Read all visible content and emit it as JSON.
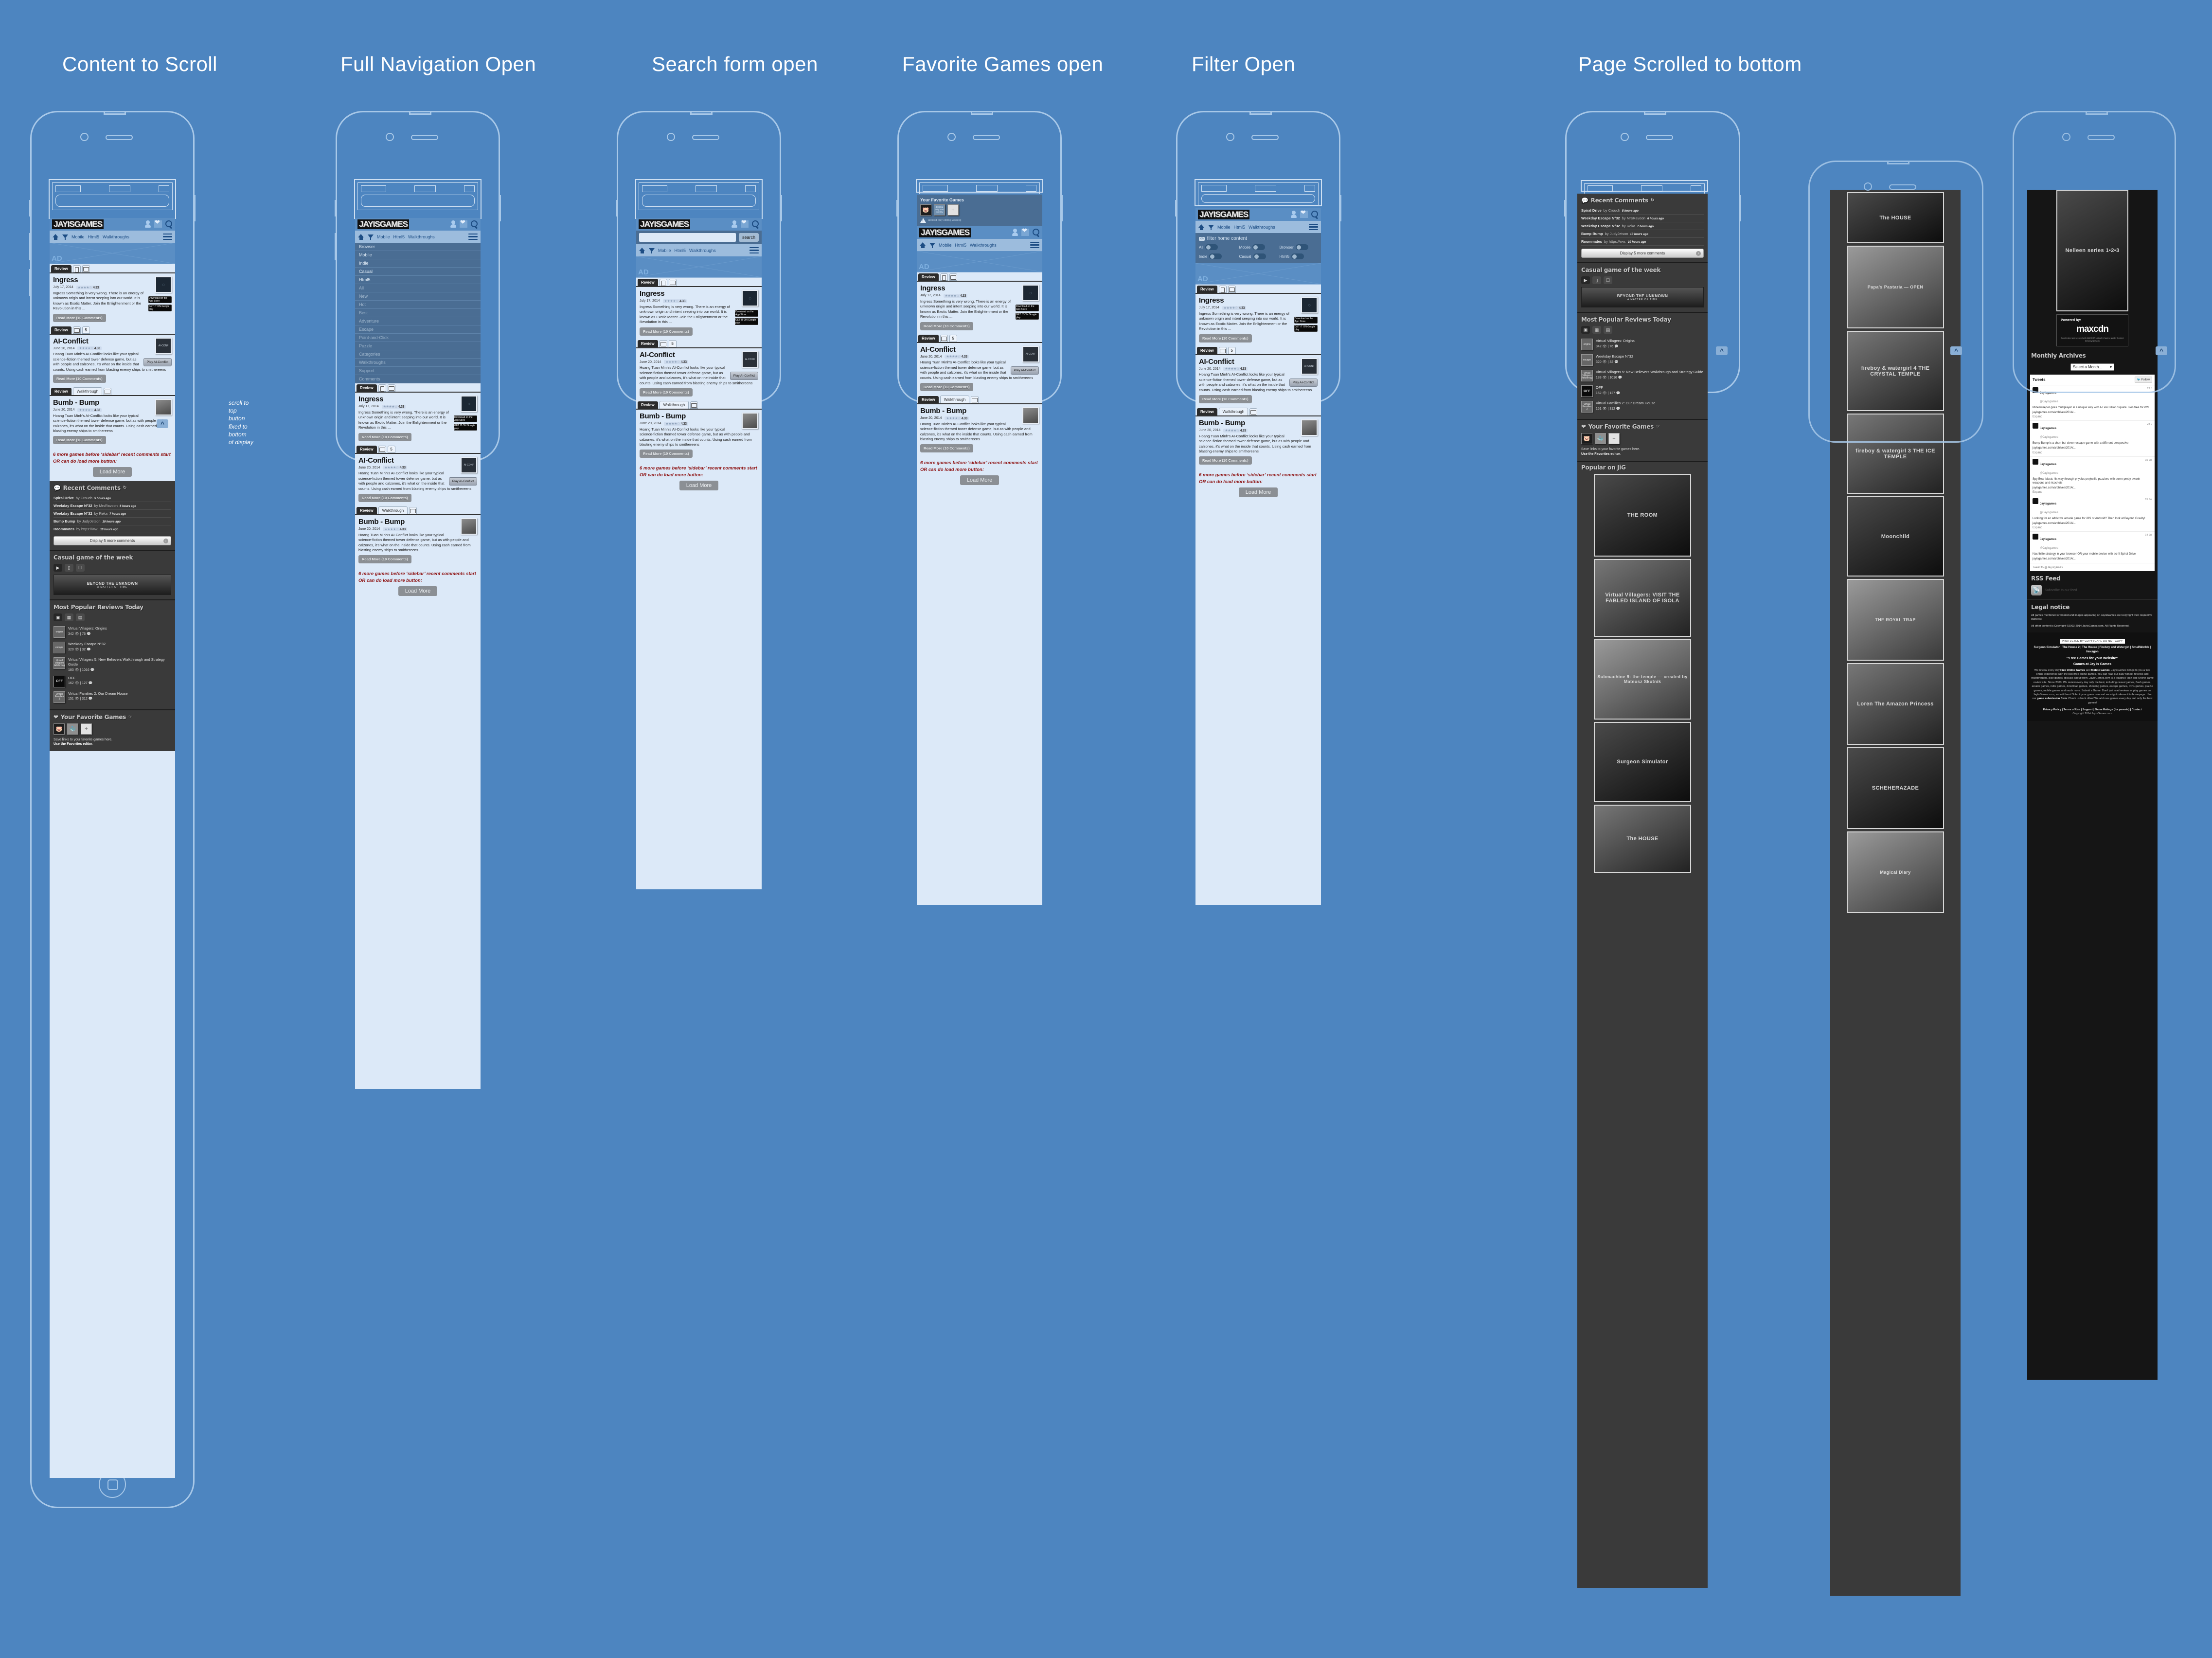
{
  "columns": [
    {
      "title": "Content  to Scroll"
    },
    {
      "title": "Full Navigation Open"
    },
    {
      "title": "Search form open"
    },
    {
      "title": "Favorite Games open"
    },
    {
      "title": "Filter Open"
    },
    {
      "title": "Page Scrolled to bottom"
    }
  ],
  "annotations": {
    "scroll_top": "scroll to\ntop\nbutton\nfixed to\nbottom\nof display"
  },
  "site": {
    "logo": "JAYISGAMES",
    "header_icons": [
      "user-icon",
      "favorites-heart-icon",
      "search-icon"
    ],
    "nav": {
      "home_icon": "home-icon",
      "filter_icon": "filter-icon",
      "links": [
        "Mobile",
        "Html5",
        "Walkthroughs"
      ],
      "burger_icon": "hamburger-menu-icon"
    },
    "ad_label": "AD"
  },
  "nav_dropdown": {
    "primary": [
      "Browser",
      "Mobile",
      "Indie",
      "Casual",
      "Html5"
    ],
    "secondary": [
      "All",
      "New",
      "Hot",
      "Best",
      "Adventure",
      "Escape",
      "Point-and-Click",
      "Puzzle",
      "Categories",
      "Walkthroughs",
      "Support",
      "Comments"
    ]
  },
  "search_panel": {
    "value": "",
    "placeholder": "",
    "button": "search"
  },
  "favorites_panel": {
    "heading": "Your Favorite Games",
    "tiles": [
      "game-thumb-1",
      "desktop only icon overlay",
      "+"
    ],
    "warning": "android only editing warning"
  },
  "filter_panel": {
    "icon_label": "icn",
    "heading": "filter home content",
    "toggles": [
      {
        "label": "All",
        "on": false
      },
      {
        "label": "Mobile",
        "on": false
      },
      {
        "label": "Browser",
        "on": false
      },
      {
        "label": "Indie",
        "on": false
      },
      {
        "label": "Casual",
        "on": false
      },
      {
        "label": "Html5",
        "on": false
      }
    ]
  },
  "articles": [
    {
      "tabs": {
        "active": "Review",
        "icons": [
          "mobile-phone-icon",
          "tablet-icon"
        ]
      },
      "title": "Ingress",
      "date": "July 17, 2014",
      "rating": "4.33",
      "body": "Ingress Something is very wrong. There is an energy of unknown origin and intent seeping into our world. It is known as Exotic Matter. Join the Enlightenment or the Revolution in this ...",
      "thumb": "ingress-logo",
      "buttons": [
        "Download on the App Store",
        "GET IT ON Google play"
      ],
      "read_more": "Read More (10 Comments)"
    },
    {
      "tabs": {
        "active": "Review",
        "icons": [
          "desktop-icon",
          "html5-icon"
        ]
      },
      "title": "AI-Conflict",
      "date": "June 20, 2014",
      "rating": "4.33",
      "body": "Hoang Tuan Minh's AI-Conflict looks like your typical science-fiction themed tower defense game, but as with people and calzones, it's what on the inside that counts. Using cash earned from blasting enemy ships to smithereens",
      "thumb": "ai-conflict-cover",
      "play_button": "Play AI-Conflict",
      "read_more": "Read More (10 Comments)"
    },
    {
      "tabs": {
        "active": "Review",
        "second": "Walkthrough",
        "icons": [
          "desktop-icon"
        ]
      },
      "title": "Bumb - Bump",
      "date": "June 20, 2014",
      "rating": "4.33",
      "body": "Hoang Tuan Minh's AI-Conflict looks like your typical science-fiction themed tower defense game, but as with people and calzones, it's what on the inside that counts. Using cash earned from blasting enemy ships to smithereens",
      "thumb": "bump-bump-cover",
      "read_more": "Read More (10 Comments)"
    }
  ],
  "inline_note": "6 more games before ‘sidebar’ recent comments start OR can do load more button:",
  "load_more": "Load More",
  "sidebar": {
    "recent_comments": {
      "heading": "Recent Comments",
      "refresh_icon": "refresh-icon",
      "items": [
        {
          "title": "Spiral Drive",
          "by": "by Crouch",
          "ago": "5 hours ago"
        },
        {
          "title": "Weekday Escape N°32",
          "by": "by MrsRavoon",
          "ago": "6 hours ago"
        },
        {
          "title": "Weekday Escape N°32",
          "by": "by Reka",
          "ago": "7 hours ago"
        },
        {
          "title": "Bump Bump",
          "by": "by JudyJetson",
          "ago": "10 hours ago"
        },
        {
          "title": "Roommates",
          "by": "by https://ww.",
          "ago": "10 hours ago"
        }
      ],
      "more_button": "Display 5 more comments"
    },
    "casual_game": {
      "heading": "Casual game of the week",
      "tabs": [
        "controller-icon",
        "desktop-icon",
        "mobile-icon"
      ],
      "banner_title": "BEYOND THE UNKNOWN",
      "banner_sub": "A MATTER OF TIME"
    },
    "popular_reviews": {
      "heading": "Most Popular Reviews Today",
      "tabs": [
        "today-icon",
        "week-icon",
        "month-icon"
      ],
      "items": [
        {
          "thumb": "origins",
          "title": "Virtual Villagers: Origins",
          "views": "342",
          "comments": "76"
        },
        {
          "thumb": "escape",
          "title": "Weekday Escape N°32",
          "views": "320",
          "comments": "32"
        },
        {
          "thumb": "Virtual Villagers Walkthrough",
          "title": "Virtual Villagers 5: New Believers Walkthrough and Strategy Guide",
          "views": "183",
          "comments": "1016"
        },
        {
          "thumb": "OFF",
          "title": "OFF",
          "views": "162",
          "comments": "127"
        },
        {
          "thumb": "Virtual Families 2",
          "title": "Virtual Families 2: Our Dream House",
          "views": "151",
          "comments": "312"
        }
      ]
    },
    "favorite_games": {
      "heading": "Your Favorite Games",
      "edit_icon": "hand-pointer-icon",
      "tiles": [
        "sheep-game-icon",
        "pixel-game-icon",
        "+"
      ],
      "note_1": "Save links to your favorite games here.",
      "note_2": "Use the Favorites editor",
      "note_3": "."
    },
    "popular_on_jig": {
      "heading": "Popular on JiG",
      "games": [
        "THE ROOM",
        "Virtual Villagers: VISIT THE FABLED ISLAND OF ISOLA",
        "Submachine 9: the temple — created by Mateusz Skutnik",
        "Surgeon Simulator",
        "The HOUSE",
        "Papa's Pastaria — OPEN",
        "fireboy & watergirl 4 THE CRYSTAL TEMPLE",
        "fireboy & watergirl 3 THE ICE TEMPLE",
        "Moonchild",
        "THE ROYAL TRAP",
        "Loren The Amazon Princess",
        "SCHEHERAZADE",
        "Magical Diary",
        "Nelleen series 1•2•3"
      ]
    },
    "maxcdn": {
      "label": "Powered by:",
      "brand": "maxcdn",
      "note": "Accelerated and secured with MAXCDN using the fastest quality Content Delivery Network"
    },
    "monthly_archives": {
      "heading": "Monthly Archives",
      "select_value": "Select a Month..."
    },
    "tweets": {
      "heading": "Tweets",
      "follow": "Follow",
      "items": [
        {
          "name": "Jayisgames",
          "handle": "@Jayisgames",
          "date": "22 J",
          "body": "Minesweeper goes multiplayer in a unique way with A Few Billion Square Tiles free for iOS",
          "link": "jayisgames.com/archives/2014/...",
          "expand": "Expand"
        },
        {
          "name": "Jayisgames",
          "handle": "@Jayisgames",
          "date": "23 J",
          "body": "Bump Bump is a short but clever escape game with a different perspective",
          "link": "jayisgames.com/archives/2014/...",
          "expand": "Expand"
        },
        {
          "name": "Jayisgames",
          "handle": "@Jayisgames",
          "date": "15 Jul",
          "body": "Spy Bear blasts his way through physics projectile puzzlers with some pretty swank weapons and ricochets",
          "link": "jayisgames.com/archives/2014/...",
          "expand": "Expand"
        },
        {
          "name": "Jayisgames",
          "handle": "@Jayisgames",
          "date": "15 Jul",
          "body": "Looking for an addictive arcade game for iOS or Android? Then look at Beyond Gravity!",
          "link": "jayisgames.com/archives/2014/...",
          "expand": "Expand"
        },
        {
          "name": "Jayisgames",
          "handle": "@Jayisgames",
          "date": "14 Jul",
          "body": "Nachhilfe strategy in your browser OR your mobile device with sci-fi Spiral Drive",
          "link": "jayisgames.com/archives/2014/...",
          "expand": "Expand"
        }
      ],
      "compose": "Tweet to @Jayisgames"
    },
    "rss": {
      "heading": "RSS Feed",
      "link": "Subscribe to our feed"
    },
    "legal": {
      "heading": "Legal notice",
      "p1": "All games mentioned or hosted and images appearing on JayIsGames are Copyright their respective owner(s).",
      "p2": "All other content is Copyright ©2003-2014 JayIsGames.com. All Rights Reserved."
    },
    "footer": {
      "copyscape": "PROTECTED BY COPYSCAPE DO NOT COPY",
      "links": "Surgeon Simulator | The House 2 | The House | Fireboy and Watergirl | SmallWorlds | Hexagon",
      "free_games": "::Free Games for your Website::",
      "games_at": "Games at Jay Is Games",
      "blurb_1": "We review every day ",
      "blurb_b1": "Free Online Games",
      "blurb_2": " and ",
      "blurb_b2": "Mobile Games",
      "blurb_3": ". JayIsGames brings to you a free online experience with the best free online games. You can read our daily honest reviews and walkthroughs, play games, discuss about them. JayIsGames.com is a leading Flash and Online game review site. Since 2003. We review every day only the best, including casual games, flash games, arcade games, indie games, download games, shooting games, escape games, RPG games, puzzle games, mobile games and much more. Submit a Game: Don't just read reviews or play games on JayIsGames.com, submit them! Submit your game now and we might release it in homepage. Use our ",
      "blurb_b3": "game submission form",
      "blurb_4": ". Check us back often! We add new games every day and only the best games!",
      "bottom_links": "Privacy Policy | Terms of Use | Support | Game Ratings (for parents) | Contact",
      "copyright": "Copyright 2014 JayIsGames.com"
    }
  }
}
